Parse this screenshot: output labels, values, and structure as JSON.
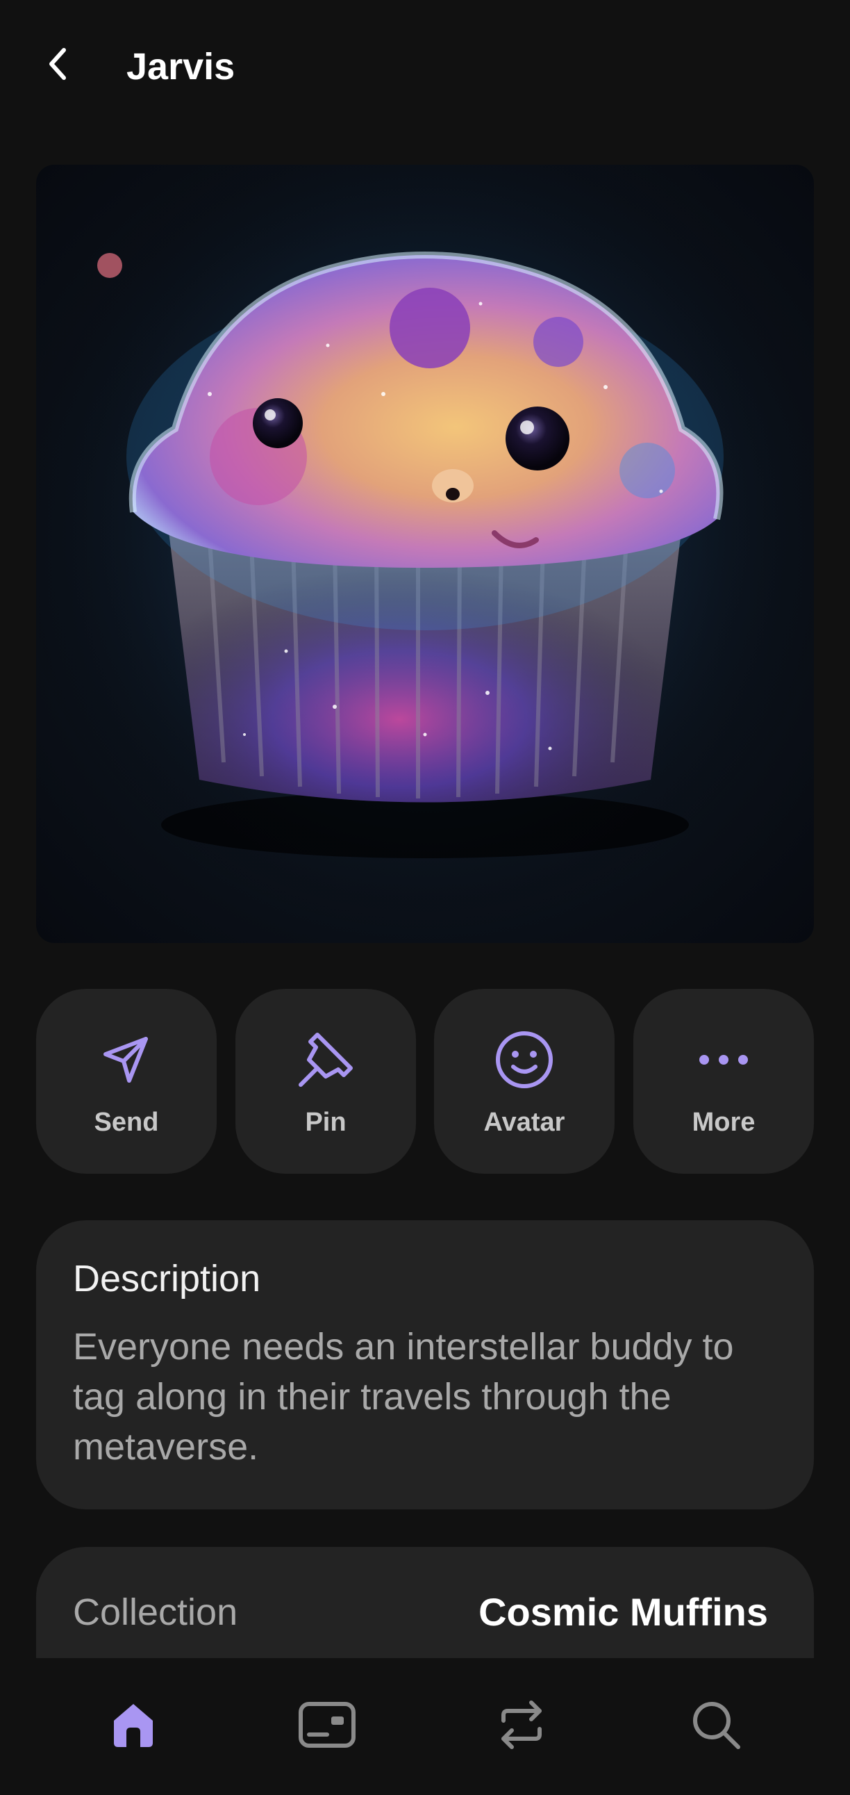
{
  "header": {
    "title": "Jarvis",
    "back_icon": "chevron-left-icon"
  },
  "nft": {
    "image_subject": "cosmic-muffin-artwork"
  },
  "actions": [
    {
      "label": "Send",
      "icon": "send-icon"
    },
    {
      "label": "Pin",
      "icon": "pin-icon"
    },
    {
      "label": "Avatar",
      "icon": "smiley-icon"
    },
    {
      "label": "More",
      "icon": "more-dots-icon"
    }
  ],
  "description": {
    "title": "Description",
    "text": "Everyone needs an interstellar buddy to tag along in their travels through the metaverse."
  },
  "collection": {
    "label": "Collection",
    "value": "Cosmic Muffins"
  },
  "bottom_nav": {
    "items": [
      {
        "icon": "home-icon",
        "active": true
      },
      {
        "icon": "wallet-card-icon",
        "active": false
      },
      {
        "icon": "swap-arrows-icon",
        "active": false
      },
      {
        "icon": "search-icon",
        "active": false
      }
    ]
  },
  "colors": {
    "background": "#111111",
    "card": "#232323",
    "accent": "#a996f2",
    "inactive_icon": "#8a8a8a"
  }
}
